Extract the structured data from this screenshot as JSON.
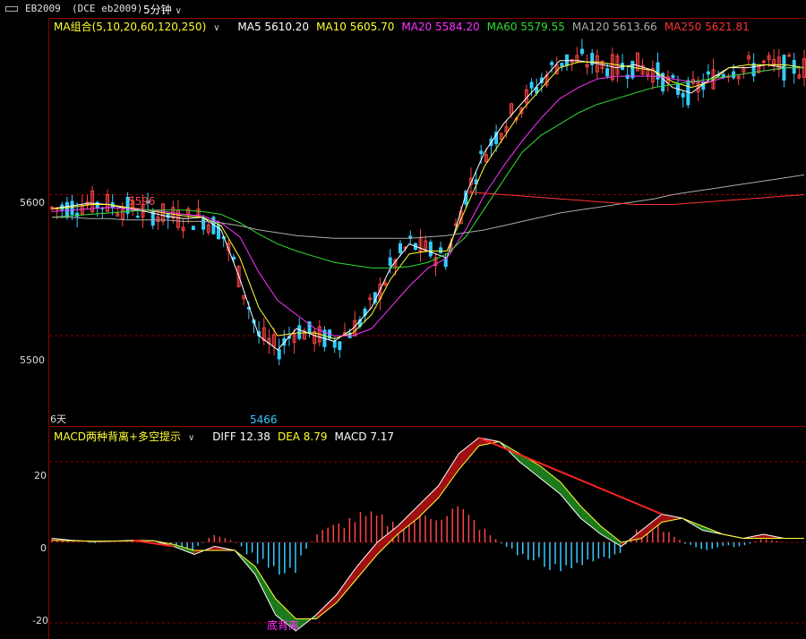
{
  "header": {
    "symbol": "EB2009",
    "exchange": "(DCE eb2009)",
    "period": "5分钟"
  },
  "ma_legend": {
    "title": "MA组合(5,10,20,60,120,250)",
    "items": [
      {
        "label": "MA5",
        "value": "5610.20",
        "color": "#ffffff"
      },
      {
        "label": "MA10",
        "value": "5605.70",
        "color": "#ffff33"
      },
      {
        "label": "MA20",
        "value": "5584.20",
        "color": "#ff33ff"
      },
      {
        "label": "MA60",
        "value": "5579.55",
        "color": "#33dd33"
      },
      {
        "label": "MA120",
        "value": "5613.66",
        "color": "#aaaaaa"
      },
      {
        "label": "MA250",
        "value": "5621.81",
        "color": "#ff3333"
      }
    ]
  },
  "macd_legend": {
    "title": "MACD两种背离+多空提示",
    "items": [
      {
        "label": "DIFF",
        "value": "12.38",
        "color": "#ffffff"
      },
      {
        "label": "DEA",
        "value": "8.79",
        "color": "#ffff33"
      },
      {
        "label": "MACD",
        "value": "7.17",
        "color": "#ffffff"
      }
    ]
  },
  "annotations": {
    "high_label": "5596",
    "low_label": "5466",
    "days_label": "6天",
    "divergence_label": "底背离"
  },
  "chart_data": [
    {
      "type": "line",
      "title": "",
      "yticks": [
        "5600",
        "5500"
      ],
      "ylim": [
        5436,
        5724
      ],
      "grid": true,
      "note_series": "MA lines approximated; candlesticks sampled",
      "series": [
        {
          "name": "MA5",
          "color": "#ffffff",
          "values": [
            5590,
            5592,
            5594,
            5593,
            5590,
            5588,
            5585,
            5583,
            5584,
            5575,
            5540,
            5500,
            5490,
            5505,
            5500,
            5496,
            5505,
            5520,
            5548,
            5565,
            5560,
            5555,
            5600,
            5630,
            5650,
            5665,
            5680,
            5695,
            5695,
            5693,
            5690,
            5692,
            5688,
            5676,
            5672,
            5682,
            5690,
            5690,
            5692,
            5690,
            5690
          ]
        },
        {
          "name": "MA10",
          "color": "#ffff33",
          "values": [
            5590,
            5591,
            5593,
            5593,
            5591,
            5589,
            5587,
            5585,
            5584,
            5578,
            5555,
            5520,
            5500,
            5502,
            5502,
            5498,
            5502,
            5515,
            5540,
            5558,
            5560,
            5560,
            5590,
            5620,
            5640,
            5660,
            5675,
            5690,
            5694,
            5694,
            5692,
            5690,
            5688,
            5680,
            5676,
            5680,
            5690,
            5692,
            5692,
            5692,
            5690
          ]
        },
        {
          "name": "MA20",
          "color": "#ff33ff",
          "values": [
            5588,
            5589,
            5590,
            5591,
            5590,
            5589,
            5588,
            5586,
            5585,
            5580,
            5570,
            5545,
            5525,
            5515,
            5505,
            5500,
            5500,
            5505,
            5520,
            5535,
            5548,
            5555,
            5575,
            5600,
            5620,
            5638,
            5654,
            5668,
            5676,
            5682,
            5684,
            5684,
            5684,
            5682,
            5680,
            5680,
            5684,
            5686,
            5688,
            5690,
            5690
          ]
        },
        {
          "name": "MA60",
          "color": "#33dd33",
          "values": [
            5584,
            5585,
            5586,
            5587,
            5588,
            5589,
            5589,
            5589,
            5588,
            5586,
            5580,
            5572,
            5565,
            5560,
            5556,
            5552,
            5550,
            5548,
            5548,
            5549,
            5552,
            5558,
            5570,
            5590,
            5610,
            5630,
            5642,
            5650,
            5658,
            5664,
            5668,
            5672,
            5676,
            5678,
            5680,
            5682,
            5684,
            5686,
            5688,
            5690,
            5690
          ]
        },
        {
          "name": "MA120",
          "color": "#aaaaaa",
          "values": [
            5584,
            5584,
            5583,
            5583,
            5582,
            5582,
            5582,
            5581,
            5581,
            5580,
            5578,
            5575,
            5573,
            5571,
            5570,
            5569,
            5569,
            5569,
            5569,
            5569,
            5570,
            5571,
            5573,
            5575,
            5578,
            5581,
            5584,
            5587,
            5589,
            5591,
            5593,
            5595,
            5597,
            5600,
            5602,
            5604,
            5606,
            5608,
            5610,
            5612,
            5614
          ]
        },
        {
          "name": "MA250",
          "color": "#ff3333",
          "values": [
            null,
            null,
            null,
            null,
            null,
            null,
            null,
            null,
            null,
            null,
            null,
            null,
            null,
            null,
            null,
            null,
            null,
            null,
            null,
            null,
            null,
            null,
            5602,
            5601,
            5600,
            5599,
            5598,
            5597,
            5596,
            5595,
            5594,
            5593,
            5593,
            5593,
            5594,
            5595,
            5596,
            5597,
            5598,
            5599,
            5600
          ]
        }
      ]
    },
    {
      "type": "bar",
      "title": "",
      "yticks": [
        "20",
        "0",
        "-20"
      ],
      "ylim": [
        -24,
        28
      ],
      "grid": true,
      "series": [
        {
          "name": "DIFF",
          "color": "#ffffff",
          "values": [
            1,
            0.5,
            0.2,
            0.3,
            0.5,
            0.4,
            -1,
            -3,
            -1,
            -2,
            -8,
            -18,
            -22,
            -18,
            -13,
            -6,
            0,
            4,
            9,
            14,
            22,
            26,
            25,
            20,
            16,
            12,
            6,
            2,
            -1,
            3,
            7,
            6,
            3,
            2,
            1,
            2,
            1,
            1
          ]
        },
        {
          "name": "DEA",
          "color": "#ffff33",
          "values": [
            0.5,
            0.4,
            0.3,
            0.3,
            0.4,
            0.4,
            -0.5,
            -2,
            -2,
            -2,
            -6,
            -14,
            -19,
            -19,
            -15,
            -9,
            -3,
            2,
            6,
            11,
            18,
            24,
            25,
            22,
            19,
            15,
            9,
            4,
            0,
            1,
            5,
            6,
            4,
            2,
            1,
            1,
            1,
            1
          ]
        },
        {
          "name": "MACD",
          "color": "#ffffff",
          "values": [
            1,
            0.3,
            -0.2,
            0,
            0.2,
            0,
            -1,
            -2,
            2,
            0,
            -4,
            -8,
            -6,
            2,
            4,
            6,
            6,
            4,
            6,
            7,
            8,
            4,
            0,
            -3,
            -5,
            -6,
            -6,
            -4,
            -2,
            4,
            4,
            0,
            -2,
            -1,
            -1,
            1,
            0,
            0
          ]
        }
      ]
    }
  ]
}
